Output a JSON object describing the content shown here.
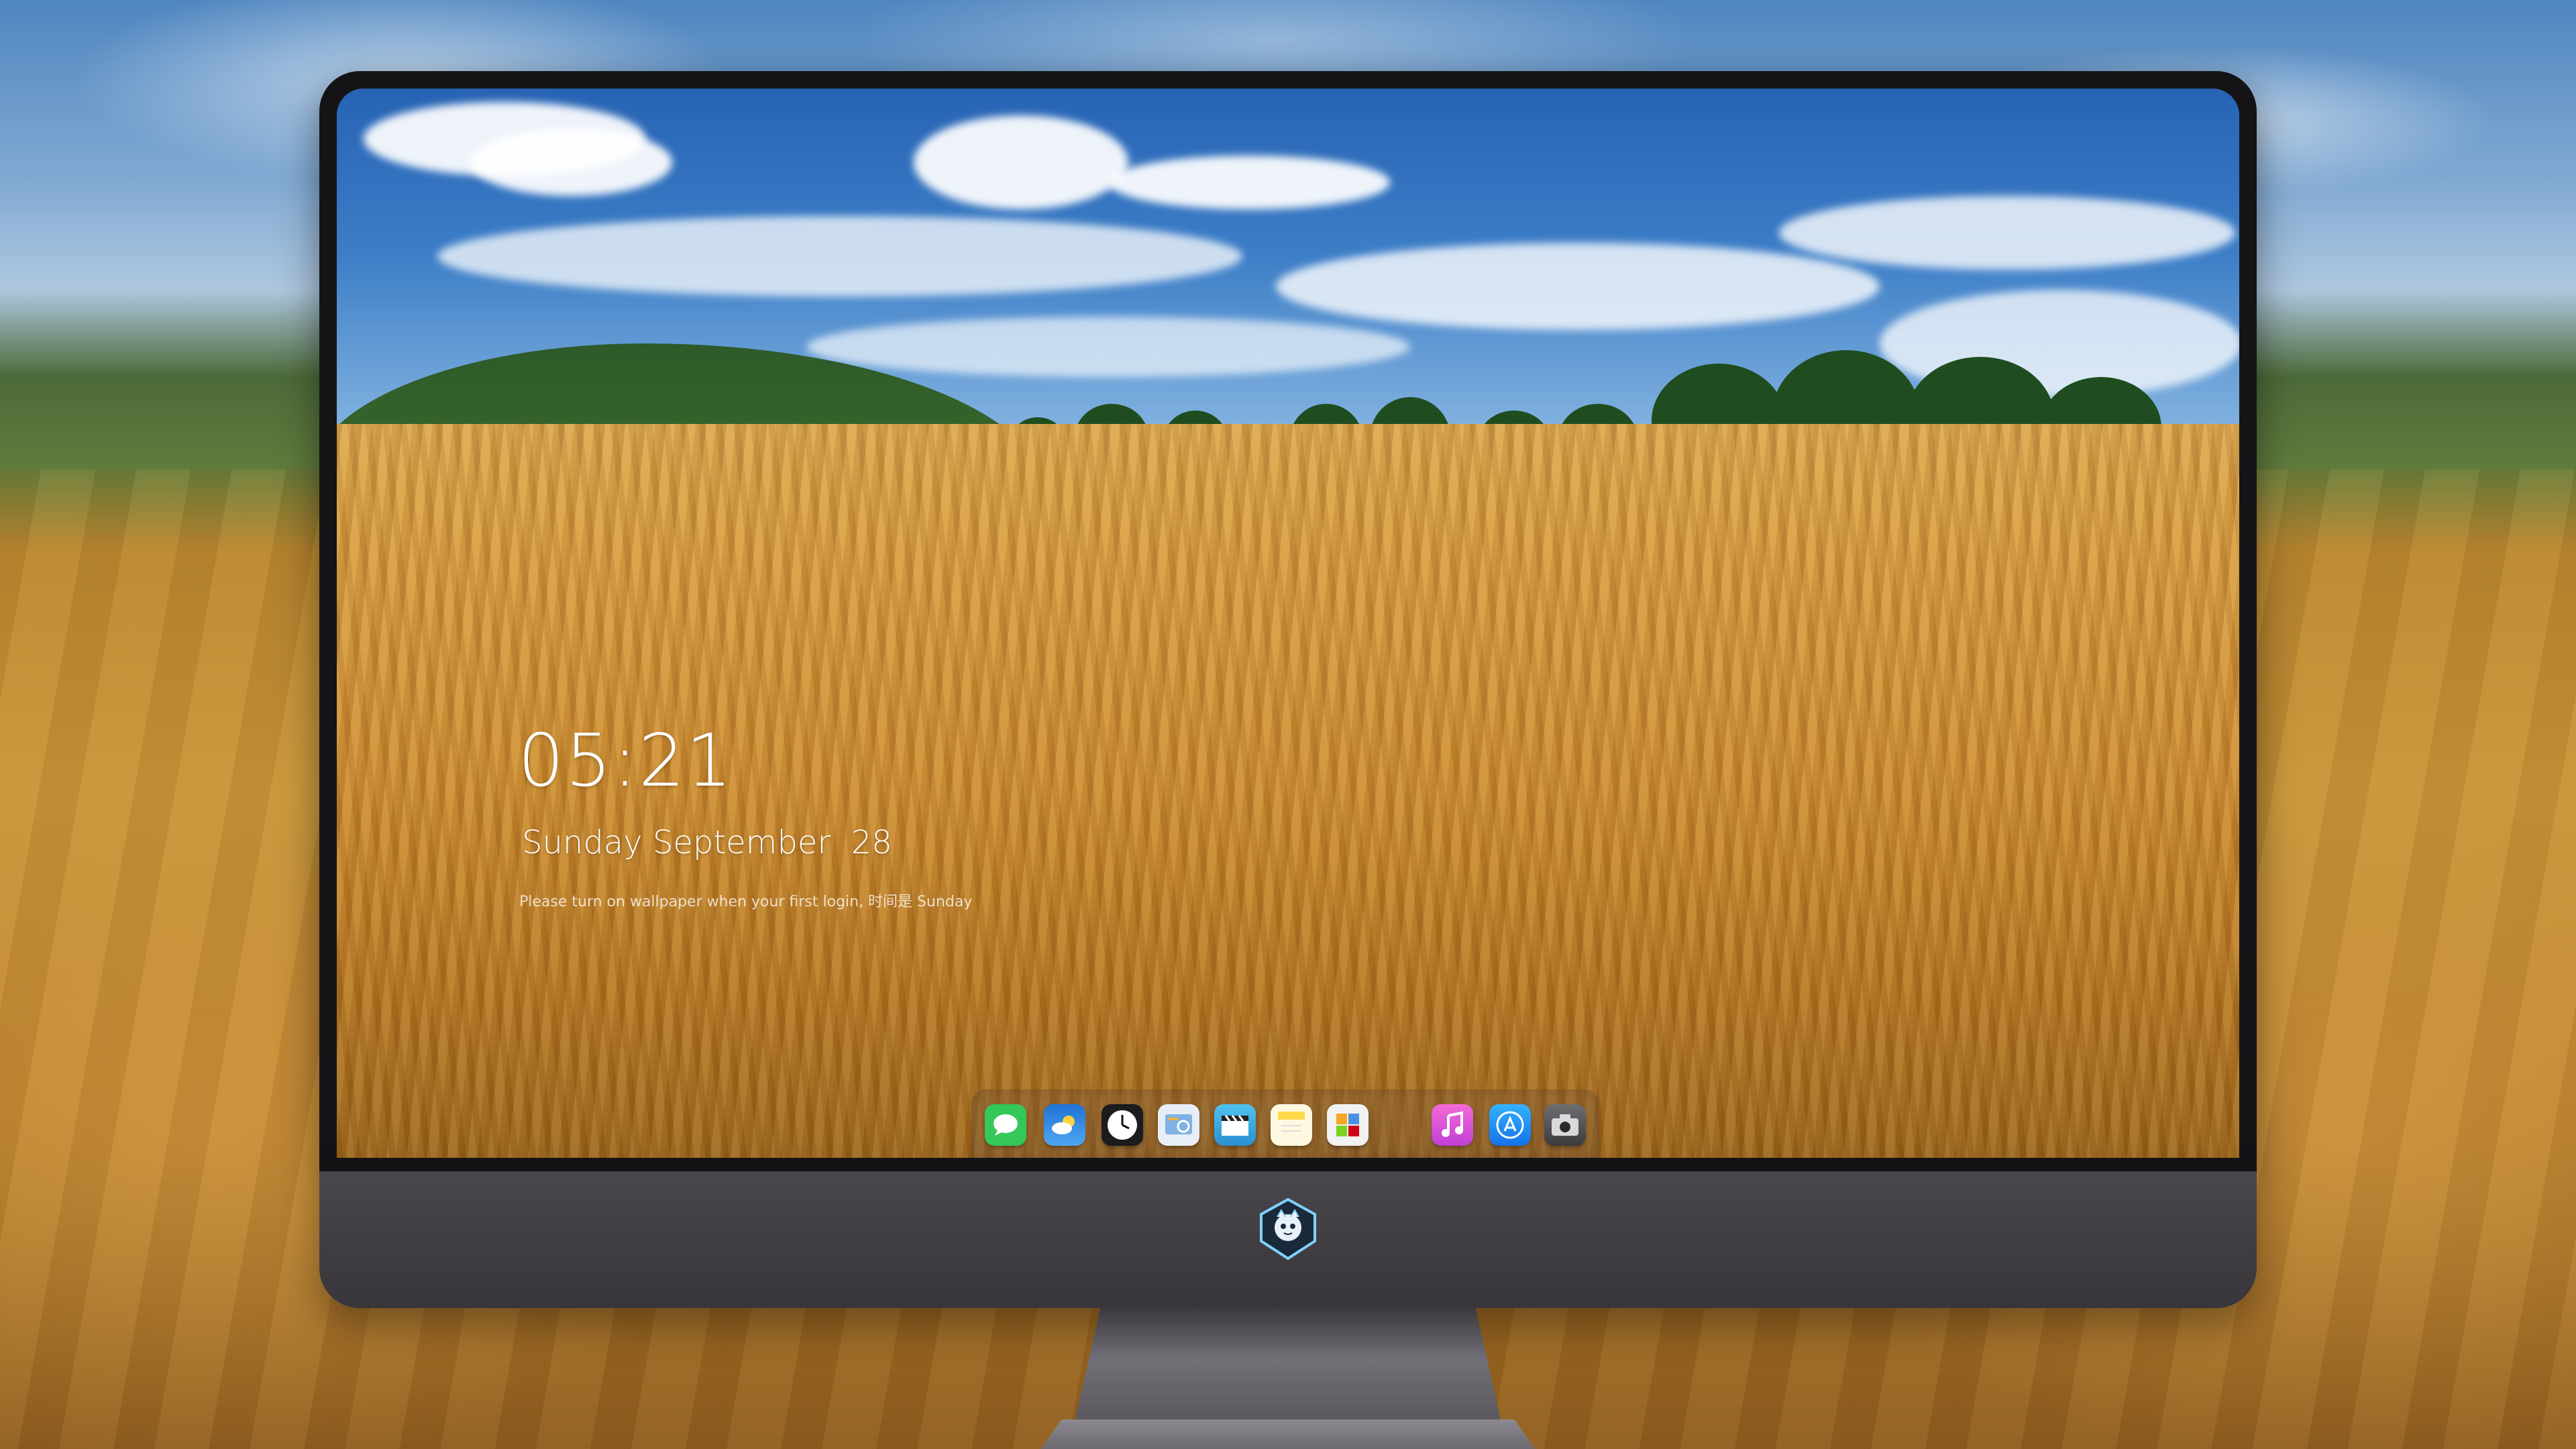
{
  "lock_screen": {
    "time": "05:21",
    "date": "Sunday September  28",
    "subtext": "Please turn on wallpaper when your first login, 时间是 Sunday"
  },
  "dock": {
    "apps": [
      {
        "name": "messages",
        "icon": "messages-icon",
        "color": "#34c759"
      },
      {
        "name": "weather",
        "icon": "weather-icon",
        "color": "#2f8ae6"
      },
      {
        "name": "clock",
        "icon": "clock-icon",
        "color": "#1c1c1e"
      },
      {
        "name": "preview",
        "icon": "preview-icon",
        "color": "#e8eef6"
      },
      {
        "name": "video",
        "icon": "clapperboard-icon",
        "color": "#3aa7e0"
      },
      {
        "name": "notes",
        "icon": "notes-icon",
        "color": "#ffd84a"
      },
      {
        "name": "photos",
        "icon": "photos-icon",
        "color": "#f2f2f2"
      },
      {
        "name": "music",
        "icon": "music-icon",
        "color": "#e04fd8"
      },
      {
        "name": "app-store",
        "icon": "app-store-icon",
        "color": "#1e90f0"
      },
      {
        "name": "camera",
        "icon": "camera-icon",
        "color": "#3c3c3e"
      }
    ]
  }
}
